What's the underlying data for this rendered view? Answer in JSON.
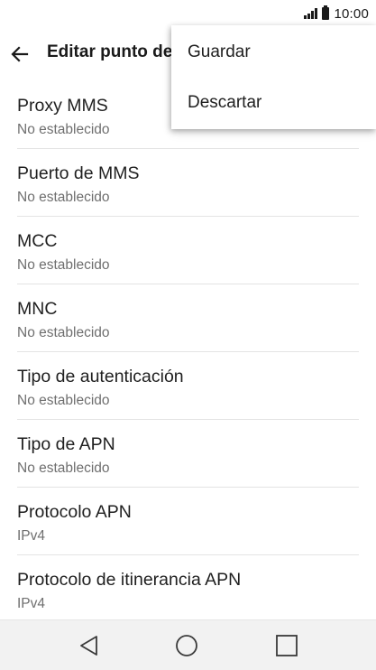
{
  "status_bar": {
    "time": "10:00",
    "icons": [
      "signal-icon",
      "battery-icon"
    ]
  },
  "action_bar": {
    "title": "Editar punto de",
    "back_icon": "arrow-left-icon"
  },
  "menu": {
    "items": [
      {
        "label": "Guardar"
      },
      {
        "label": "Descartar"
      }
    ]
  },
  "settings": {
    "items": [
      {
        "title": "Proxy MMS",
        "summary": "No establecido"
      },
      {
        "title": "Puerto de MMS",
        "summary": "No establecido"
      },
      {
        "title": "MCC",
        "summary": "No establecido"
      },
      {
        "title": "MNC",
        "summary": "No establecido"
      },
      {
        "title": "Tipo de autenticación",
        "summary": "No establecido"
      },
      {
        "title": "Tipo de APN",
        "summary": "No establecido"
      },
      {
        "title": "Protocolo APN",
        "summary": "IPv4"
      },
      {
        "title": "Protocolo de itinerancia APN",
        "summary": "IPv4"
      }
    ]
  },
  "nav_bar": {
    "icons": [
      "back-triangle-icon",
      "home-circle-icon",
      "recents-square-icon"
    ]
  },
  "colors": {
    "background": "#ffffff",
    "text_primary": "#1f1f1f",
    "text_secondary": "#6f6f6f",
    "divider": "#e4e4e4",
    "nav_bar": "#f2f2f2"
  }
}
